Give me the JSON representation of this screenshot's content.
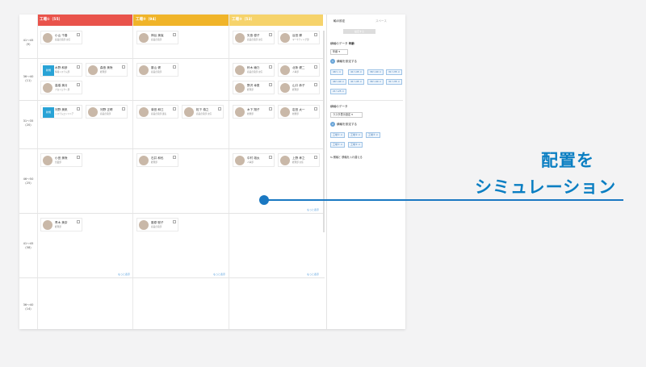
{
  "columns": [
    {
      "title": "工場①（55）",
      "color": "#e9534b"
    },
    {
      "title": "工場②（94）",
      "color": "#f0b429"
    },
    {
      "title": "工場③（53）",
      "color": "#f6d36b"
    }
  ],
  "rows": [
    {
      "label": "41〜45",
      "count": "(9)"
    },
    {
      "label": "36〜40",
      "count": "(11)"
    },
    {
      "label": "31〜35",
      "count": "(20)"
    },
    {
      "label": "46〜50",
      "count": "(25)"
    },
    {
      "label": "41〜45",
      "count": "(58)"
    },
    {
      "label": "36〜40",
      "count": "(14)"
    }
  ],
  "more_label": "もっと表示",
  "cards": [
    {
      "name": "小山 千春",
      "sub": "商品企画部 主任"
    },
    {
      "name": "神谷 美保",
      "sub": "商品企画部"
    },
    {
      "name": "矢島 優子",
      "sub": "商品企画部 主任"
    },
    {
      "name": "谷田 輝",
      "sub": "マーケティング部"
    },
    {
      "name": "水野 和彦",
      "sub": "情報システム部"
    },
    {
      "name": "森島 美咲",
      "sub": "経理部"
    },
    {
      "name": "藤山 健",
      "sub": "商品企画部"
    },
    {
      "name": "鈴木 綾乃",
      "sub": "商品企画部 主任"
    },
    {
      "name": "北条 健二",
      "sub": "人事部"
    },
    {
      "name": "高橋 美月",
      "sub": "プロジェクト部"
    },
    {
      "name": "野沢 幸恵",
      "sub": "経理部"
    },
    {
      "name": "山口 恭子",
      "sub": "経理部"
    },
    {
      "name": "河野 美帆",
      "sub": "システムエンジニア"
    },
    {
      "name": "河野 正晴",
      "sub": "商品企画部"
    },
    {
      "name": "菊田 和江",
      "sub": "商品企画部 課長"
    },
    {
      "name": "松下 慎之",
      "sub": "商品企画部 主任"
    },
    {
      "name": "木下 翔子",
      "sub": "総務部"
    },
    {
      "name": "岩田 太一",
      "sub": "総務部"
    },
    {
      "name": "小田 美咲",
      "sub": "営業部"
    },
    {
      "name": "石井 和也",
      "sub": "経理部"
    },
    {
      "name": "中村 雄太",
      "sub": "人事部"
    },
    {
      "name": "上野 孝之",
      "sub": "経理部 主任"
    },
    {
      "name": "青木 美奈",
      "sub": "経理部"
    },
    {
      "name": "藤原 聡子",
      "sub": "商品企画部"
    }
  ],
  "panel": {
    "tab_active": "軸の設定",
    "tab_inactive": "スペース",
    "apply_button": "設定する",
    "horizontal_label": "横軸のデータ",
    "horizontal_sub": "年齢",
    "horizontal_select": "年齢",
    "step1": "1",
    "step1_text": "横軸を設定する",
    "age_chips": [
      "46〜",
      "41〜45",
      "36〜40",
      "31〜35",
      "46〜40",
      "41〜45",
      "36〜40",
      "31〜35",
      "21〜25"
    ],
    "vertical_label": "横軸のデータ",
    "vertical_select": "ラスタ表示設定",
    "step2": "2",
    "step2_text": "横軸を設定する",
    "factory_chips": [
      "工場①",
      "工場②",
      "工場③",
      "工場①",
      "工場②"
    ],
    "link": "⇆ 横軸と 横軸を入れ替える"
  },
  "callout": {
    "line1": "配置を",
    "line2": "シミュレーション",
    "color": "#0a7ec2"
  }
}
